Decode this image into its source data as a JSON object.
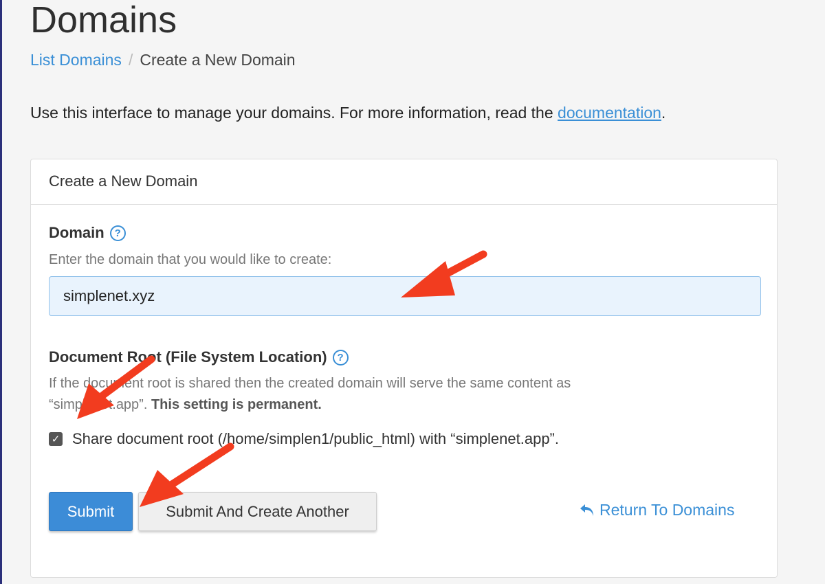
{
  "page": {
    "title": "Domains"
  },
  "breadcrumb": {
    "list_domains": "List Domains",
    "separator": "/",
    "current": "Create a New Domain"
  },
  "intro": {
    "text": "Use this interface to manage your domains. For more information, read the ",
    "link": "documentation",
    "suffix": "."
  },
  "panel": {
    "header": "Create a New Domain",
    "domain": {
      "label": "Domain",
      "help_icon": "question-circle-icon",
      "help_text": "Enter the domain that you would like to create:",
      "value": "simplenet.xyz"
    },
    "docroot": {
      "label": "Document Root (File System Location)",
      "help_icon": "question-circle-icon",
      "help_text_line1": "If the document root is shared then the created domain will serve the same content as",
      "help_text_line2": "“simplenet.app”. ",
      "help_text_bold": "This setting is permanent.",
      "checkbox_label": "Share document root (/home/simplen1/public_html) with “simplenet.app”.",
      "checked": true
    },
    "buttons": {
      "submit": "Submit",
      "submit_another": "Submit And Create Another",
      "return": "Return To Domains",
      "return_icon": "undo-arrow-icon"
    }
  },
  "colors": {
    "accent": "#3a8fd6",
    "button": "#3c8cd7",
    "annotation_arrow": "#f23c1f",
    "input_bg": "#e9f3fd"
  }
}
